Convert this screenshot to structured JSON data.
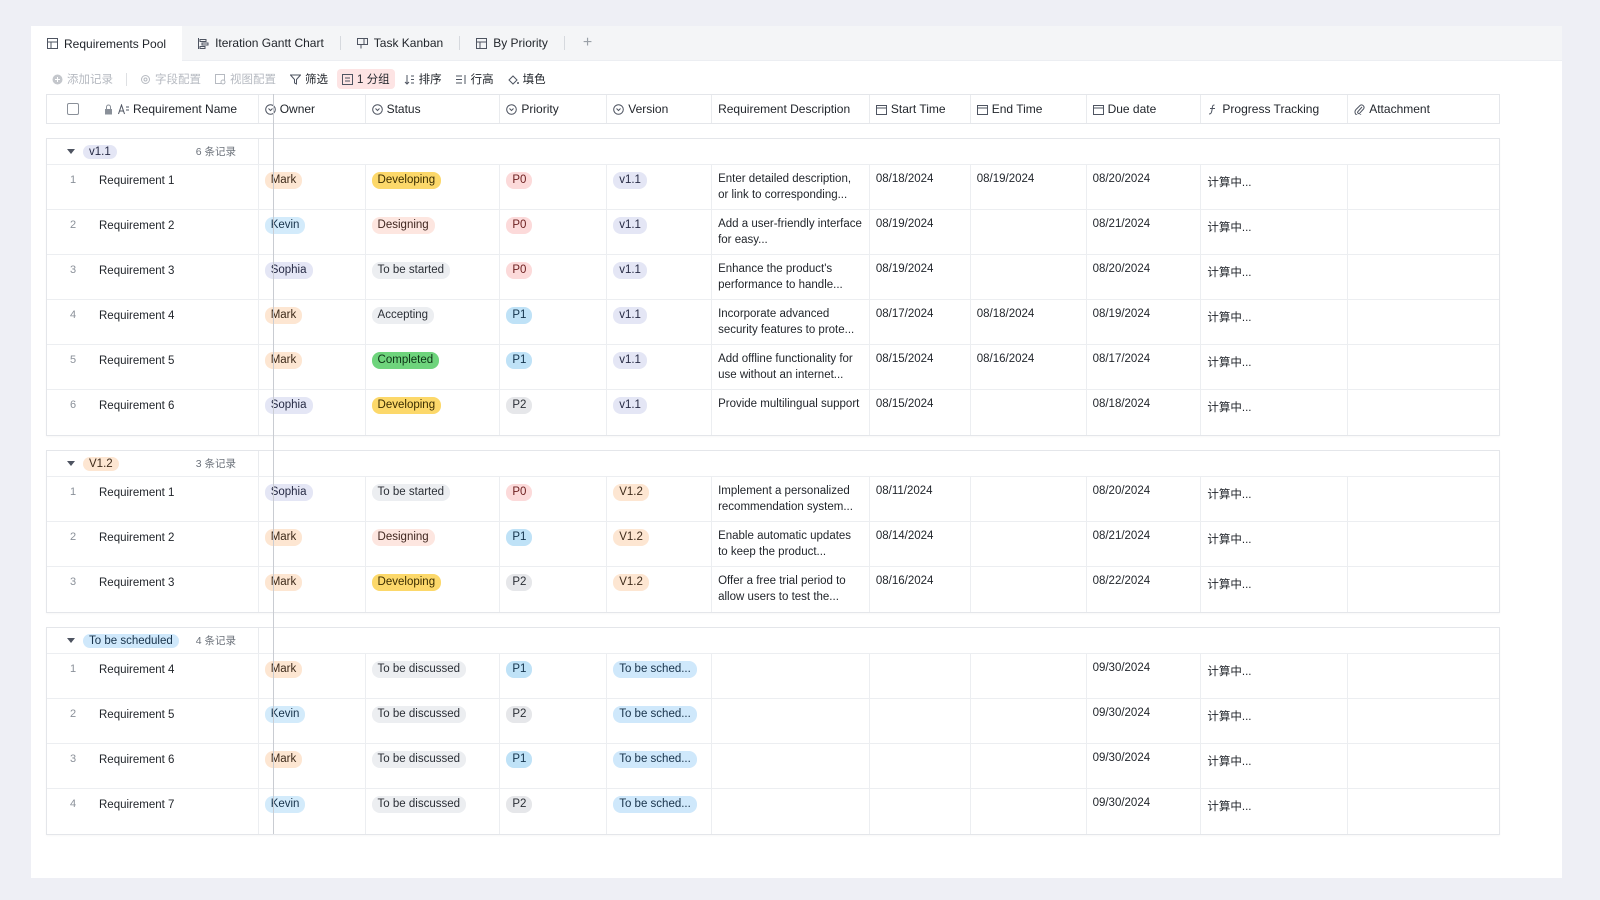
{
  "tabs": [
    {
      "label": "Requirements Pool",
      "icon": "table-icon",
      "active": true
    },
    {
      "label": "Iteration Gantt Chart",
      "icon": "gantt-icon",
      "active": false
    },
    {
      "label": "Task Kanban",
      "icon": "kanban-icon",
      "active": false
    },
    {
      "label": "By Priority",
      "icon": "table-icon",
      "active": false
    }
  ],
  "tab_add": "+",
  "toolbar": {
    "add_record": "添加记录",
    "field_config": "字段配置",
    "view_config": "视图配置",
    "filter": "筛选",
    "group": "1 分组",
    "sort": "排序",
    "row_height": "行高",
    "fill_color": "填色"
  },
  "columns": {
    "name": "Requirement Name",
    "owner": "Owner",
    "status": "Status",
    "priority": "Priority",
    "version": "Version",
    "description": "Requirement Description",
    "start": "Start Time",
    "end": "End Time",
    "due": "Due date",
    "progress": "Progress Tracking",
    "attachment": "Attachment"
  },
  "groups": [
    {
      "label": "v1.1",
      "count": "6 条记录",
      "tag_class": "t-v11",
      "rows": [
        {
          "num": "1",
          "name": "Requirement 1",
          "owner": "Mark",
          "status": "Developing",
          "priority": "P0",
          "version": "v1.1",
          "desc": "Enter detailed description, or link to corresponding...",
          "start": "08/18/2024",
          "end": "08/19/2024",
          "due": "08/20/2024",
          "progress": "计算中..."
        },
        {
          "num": "2",
          "name": "Requirement 2",
          "owner": "Kevin",
          "status": "Designing",
          "priority": "P0",
          "version": "v1.1",
          "desc": "Add a user-friendly interface for easy...",
          "start": "08/19/2024",
          "end": "",
          "due": "08/21/2024",
          "progress": "计算中..."
        },
        {
          "num": "3",
          "name": "Requirement 3",
          "owner": "Sophia",
          "status": "To be started",
          "priority": "P0",
          "version": "v1.1",
          "desc": "Enhance the product's performance to handle...",
          "start": "08/19/2024",
          "end": "",
          "due": "08/20/2024",
          "progress": "计算中..."
        },
        {
          "num": "4",
          "name": "Requirement 4",
          "owner": "Mark",
          "status": "Accepting",
          "priority": "P1",
          "version": "v1.1",
          "desc": "Incorporate advanced security features to prote...",
          "start": "08/17/2024",
          "end": "08/18/2024",
          "due": "08/19/2024",
          "progress": "计算中..."
        },
        {
          "num": "5",
          "name": "Requirement 5",
          "owner": "Mark",
          "status": "Completed",
          "priority": "P1",
          "version": "v1.1",
          "desc": "Add offline functionality for use without an internet...",
          "start": "08/15/2024",
          "end": "08/16/2024",
          "due": "08/17/2024",
          "progress": "计算中..."
        },
        {
          "num": "6",
          "name": "Requirement 6",
          "owner": "Sophia",
          "status": "Developing",
          "priority": "P2",
          "version": "v1.1",
          "desc": "Provide multilingual support",
          "start": "08/15/2024",
          "end": "",
          "due": "08/18/2024",
          "progress": "计算中..."
        }
      ]
    },
    {
      "label": "V1.2",
      "count": "3 条记录",
      "tag_class": "t-v12",
      "rows": [
        {
          "num": "1",
          "name": "Requirement 1",
          "owner": "Sophia",
          "status": "To be started",
          "priority": "P0",
          "version": "V1.2",
          "desc": "Implement a personalized recommendation system...",
          "start": "08/11/2024",
          "end": "",
          "due": "08/20/2024",
          "progress": "计算中..."
        },
        {
          "num": "2",
          "name": "Requirement 2",
          "owner": "Mark",
          "status": "Designing",
          "priority": "P1",
          "version": "V1.2",
          "desc": "Enable automatic updates to keep the product...",
          "start": "08/14/2024",
          "end": "",
          "due": "08/21/2024",
          "progress": "计算中..."
        },
        {
          "num": "3",
          "name": "Requirement 3",
          "owner": "Mark",
          "status": "Developing",
          "priority": "P2",
          "version": "V1.2",
          "desc": "Offer a free trial period to allow users to test the...",
          "start": "08/16/2024",
          "end": "",
          "due": "08/22/2024",
          "progress": "计算中..."
        }
      ]
    },
    {
      "label": "To be scheduled",
      "count": "4 条记录",
      "tag_class": "t-sched",
      "rows": [
        {
          "num": "1",
          "name": "Requirement 4",
          "owner": "Mark",
          "status": "To be discussed",
          "priority": "P1",
          "version": "To be sched...",
          "desc": "",
          "start": "",
          "end": "",
          "due": "09/30/2024",
          "progress": "计算中..."
        },
        {
          "num": "2",
          "name": "Requirement 5",
          "owner": "Kevin",
          "status": "To be discussed",
          "priority": "P2",
          "version": "To be sched...",
          "desc": "",
          "start": "",
          "end": "",
          "due": "09/30/2024",
          "progress": "计算中..."
        },
        {
          "num": "3",
          "name": "Requirement 6",
          "owner": "Mark",
          "status": "To be discussed",
          "priority": "P1",
          "version": "To be sched...",
          "desc": "",
          "start": "",
          "end": "",
          "due": "09/30/2024",
          "progress": "计算中..."
        },
        {
          "num": "4",
          "name": "Requirement 7",
          "owner": "Kevin",
          "status": "To be discussed",
          "priority": "P2",
          "version": "To be sched...",
          "desc": "",
          "start": "",
          "end": "",
          "due": "09/30/2024",
          "progress": "计算中..."
        }
      ]
    }
  ],
  "colors": {
    "developing": "#fcd86a",
    "completed": "#6ed47c",
    "p0": "#fcdada",
    "p1": "#bfe2f7",
    "group_active": "#fde4e4"
  }
}
